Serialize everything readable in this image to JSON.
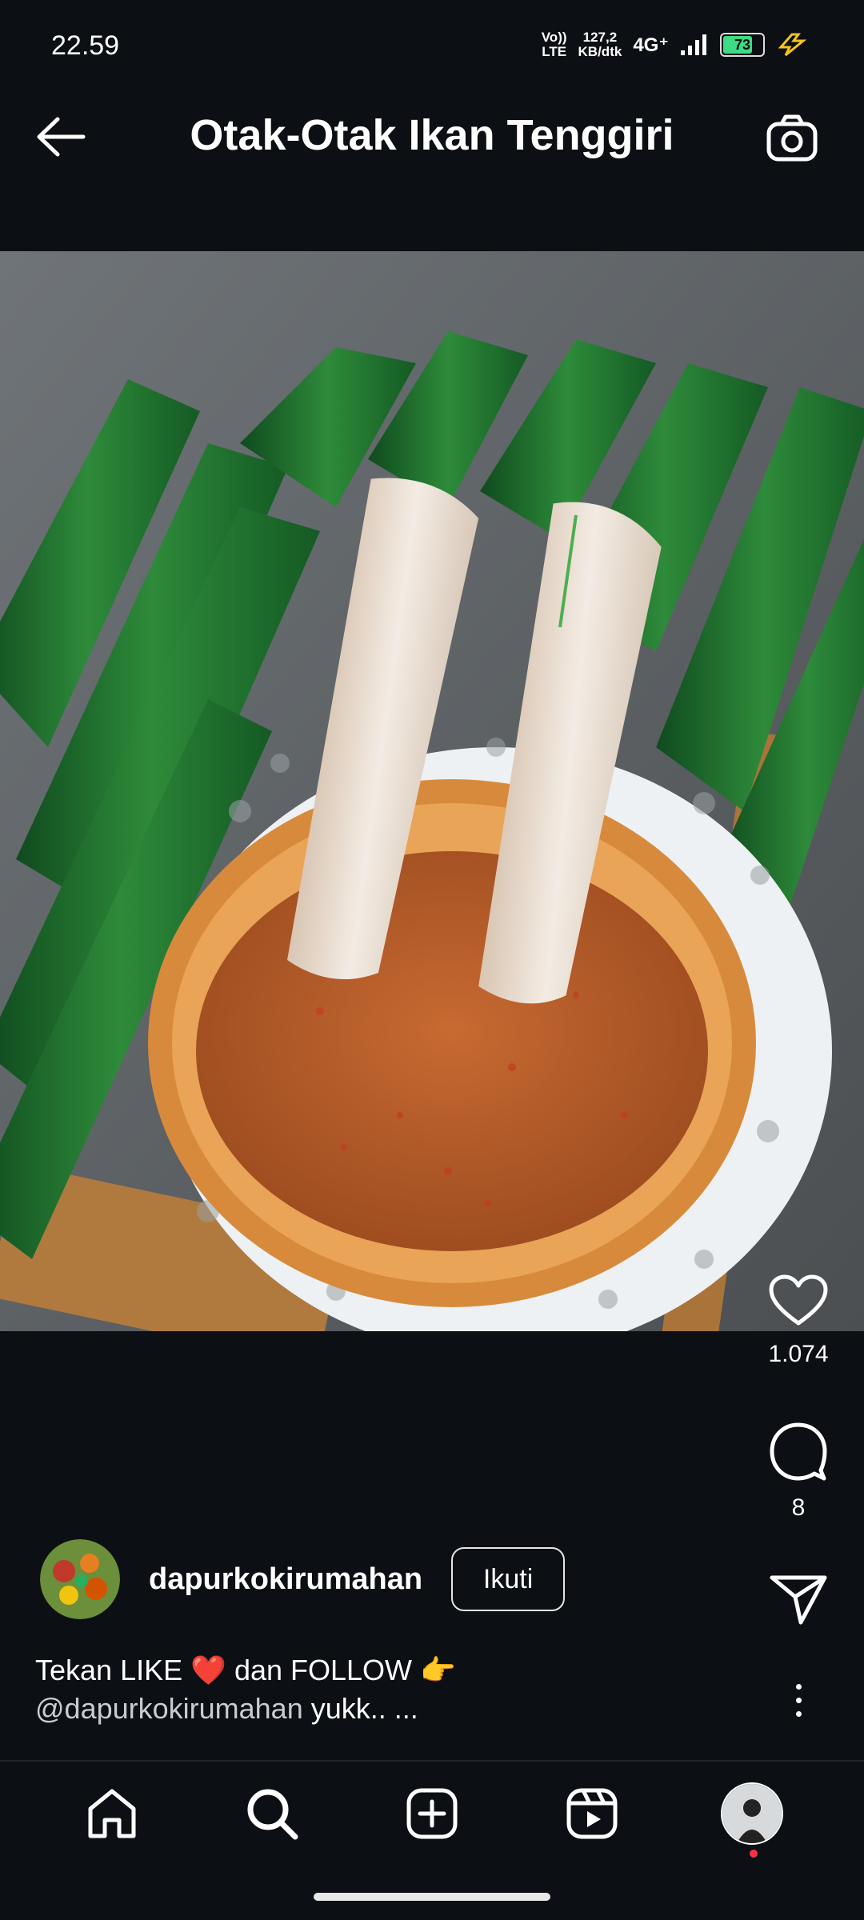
{
  "status_bar": {
    "time": "22.59",
    "volte_top": "Vo))",
    "volte_bottom": "LTE",
    "speed_value": "127,2",
    "speed_unit": "KB/dtk",
    "network": "4G⁺",
    "battery": "73"
  },
  "header": {
    "title": "Otak-Otak Ikan Tenggiri",
    "back_icon": "arrow-left-icon",
    "camera_icon": "camera-icon"
  },
  "actions": {
    "likes": "1.074",
    "comments": "8",
    "like_icon": "heart-icon",
    "comment_icon": "comment-icon",
    "share_icon": "send-icon",
    "more_icon": "more-vertical-icon"
  },
  "author": {
    "username": "dapurkokirumahan",
    "follow_label": "Ikuti"
  },
  "caption": {
    "line1_before": "Tekan LIKE ",
    "heart_emoji": "❤️",
    "line1_middle": " dan FOLLOW ",
    "point_emoji": "👉",
    "mention": "@dapurkokirumahan",
    "line2_after": " yukk.. ..."
  },
  "bottom_nav": {
    "items": [
      "home-icon",
      "search-icon",
      "create-icon",
      "reels-icon",
      "profile-avatar"
    ]
  },
  "colors": {
    "background": "#0c1014",
    "notification_dot": "#ff3040",
    "battery_fill": "#3ddc84"
  }
}
